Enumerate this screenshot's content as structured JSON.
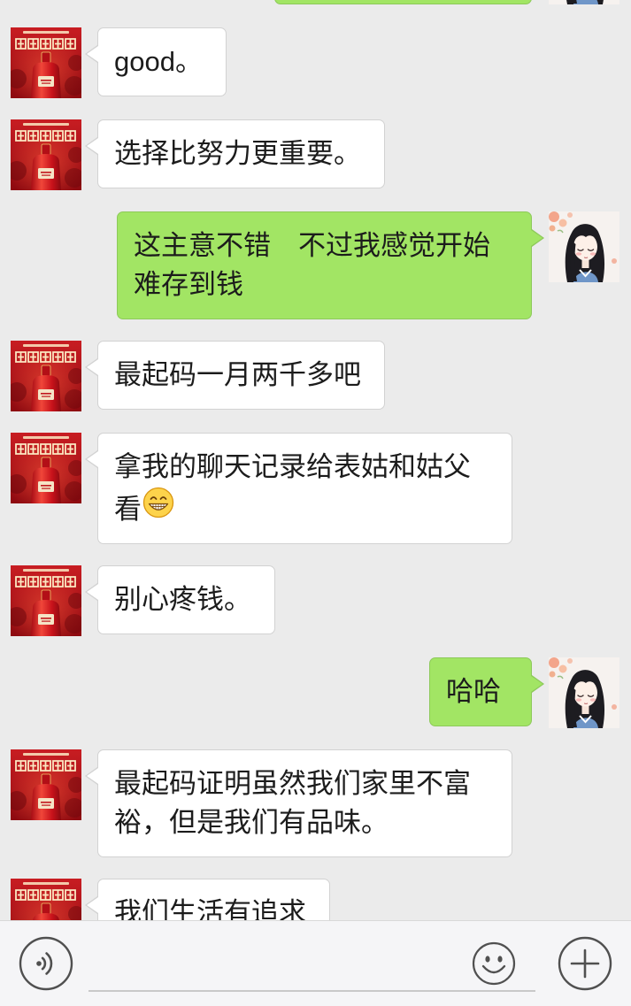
{
  "theme": {
    "background": "#ebebeb",
    "received_bubble": "#ffffff",
    "sent_bubble": "#a2e564",
    "input_bar": "#f5f5f7"
  },
  "messages": [
    {
      "outgoing": false,
      "text": "good。"
    },
    {
      "outgoing": false,
      "text": "选择比努力更重要。"
    },
    {
      "outgoing": true,
      "text": "这主意不错　不过我感觉开始难存到钱"
    },
    {
      "outgoing": false,
      "text": "最起码一月两千多吧"
    },
    {
      "outgoing": false,
      "text": "拿我的聊天记录给表姑和姑父看",
      "emoji": "grinning-face-icon"
    },
    {
      "outgoing": false,
      "text": "别心疼钱。"
    },
    {
      "outgoing": true,
      "text": "哈哈"
    },
    {
      "outgoing": false,
      "text": "最起码证明虽然我们家里不富裕，但是我们有品味。"
    },
    {
      "outgoing": false,
      "text": "我们生活有追求"
    }
  ],
  "input_bar": {
    "voice_icon": "voice-icon",
    "message_value": "",
    "emoji_icon": "emoji-icon",
    "more_icon": "plus-icon"
  }
}
